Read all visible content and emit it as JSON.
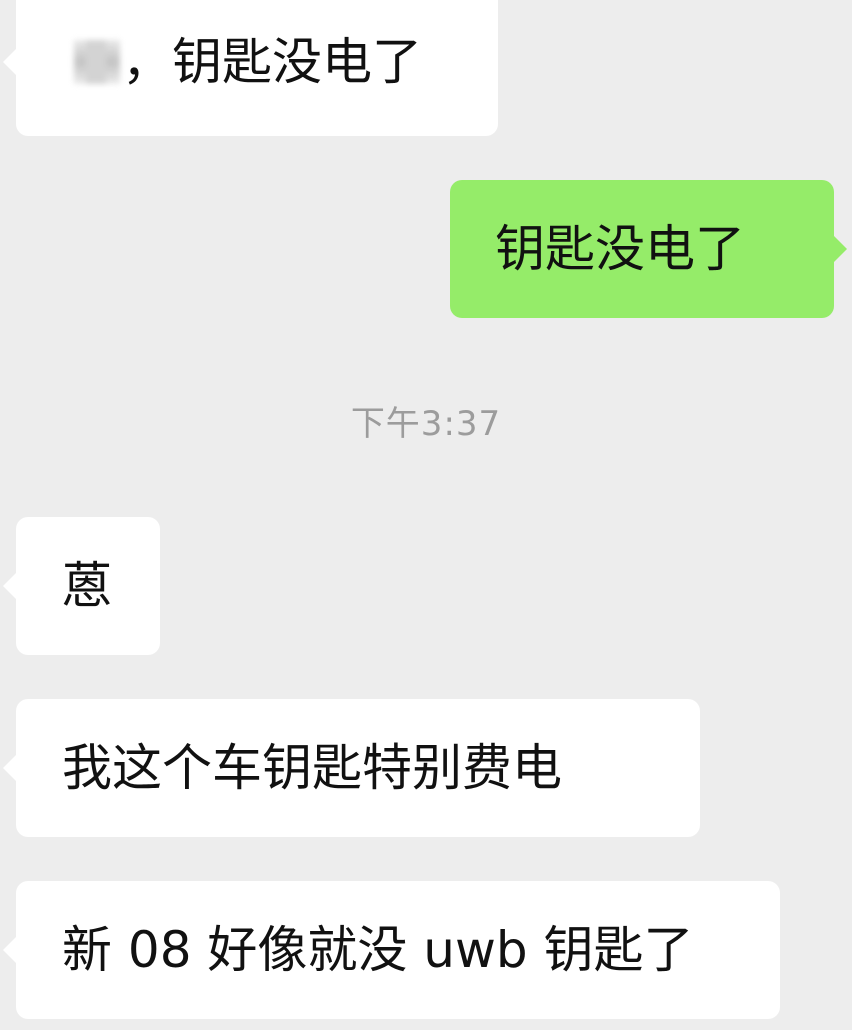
{
  "messages": [
    {
      "side": "left",
      "prefix": "，",
      "text": "钥匙没电了",
      "redacted": true
    },
    {
      "side": "right",
      "text": "钥匙没电了"
    },
    {
      "type": "timestamp",
      "text": "下午3:37"
    },
    {
      "side": "left",
      "text": "蒽"
    },
    {
      "side": "left",
      "text": "我这个车钥匙特别费电"
    },
    {
      "side": "left",
      "text": "新 08 好像就没 uwb 钥匙了"
    }
  ],
  "colors": {
    "background": "#ededed",
    "incoming_bubble": "#ffffff",
    "outgoing_bubble": "#95ec69",
    "timestamp": "#9c9c9c"
  }
}
